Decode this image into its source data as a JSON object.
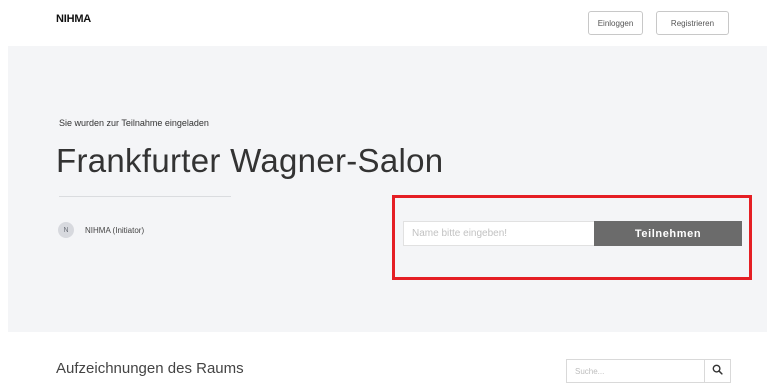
{
  "header": {
    "logo": "NIHMA",
    "login_label": "Einloggen",
    "register_label": "Registrieren"
  },
  "hero": {
    "subtitle": "Sie wurden zur Teilnahme eingeladen",
    "title": "Frankfurter Wagner-Salon",
    "initiator": {
      "avatar_letter": "N",
      "label": "NIHMA (Initiator)"
    },
    "join_form": {
      "name_placeholder": "Name bitte eingeben!",
      "name_value": "",
      "join_label": "Teilnehmen"
    }
  },
  "recordings": {
    "title": "Aufzeichnungen des Raums",
    "search_placeholder": "Suche...",
    "search_icon": "search-icon"
  },
  "colors": {
    "hero_background": "#f4f5f7",
    "join_button": "#6b6b6b",
    "highlight": "#e51f24"
  }
}
